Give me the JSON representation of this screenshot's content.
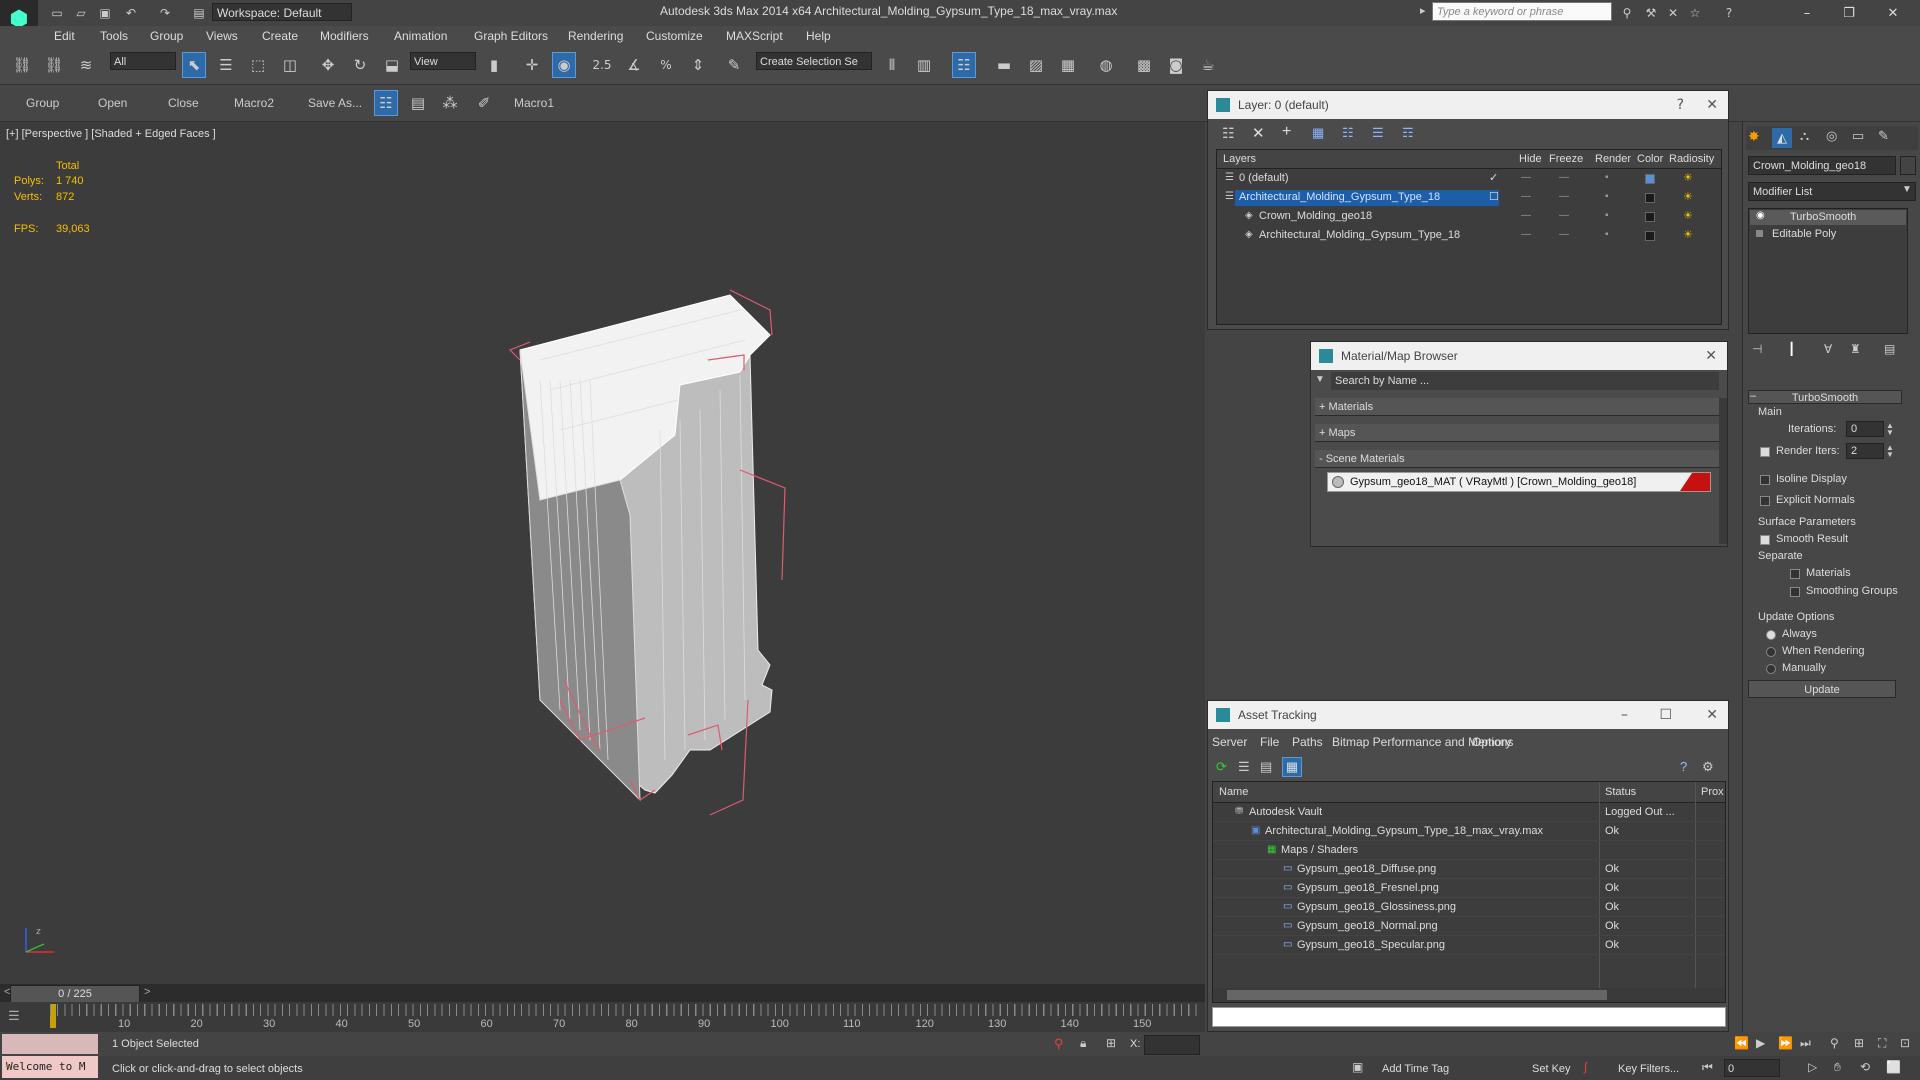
{
  "app": {
    "workspace": "Workspace: Default",
    "title": "Autodesk 3ds Max  2014 x64    Architectural_Molding_Gypsum_Type_18_max_vray.max",
    "search_placeholder": "Type a keyword or phrase"
  },
  "menu": [
    "Edit",
    "Tools",
    "Group",
    "Views",
    "Create",
    "Modifiers",
    "Animation",
    "Graph Editors",
    "Rendering",
    "Customize",
    "MAXScript",
    "Help"
  ],
  "toolbar": {
    "filter": "All",
    "ref_coord": "View",
    "snap_angle": "2.5",
    "selection_set": "Create Selection Se"
  },
  "toolbar2": [
    "Group",
    "Open",
    "Close",
    "Macro2",
    "Save As...",
    "Macro1"
  ],
  "viewport": {
    "label": "[+] [Perspective ] [Shaded + Edged Faces ]",
    "stats": {
      "total_label": "Total",
      "polys_label": "Polys:",
      "polys": "1 740",
      "verts_label": "Verts:",
      "verts": "872",
      "fps_label": "FPS:",
      "fps": "39,063"
    },
    "axis": {
      "x": "x",
      "y": "y",
      "z": "z"
    }
  },
  "timeline": {
    "position": "0 / 225",
    "ticks": [
      "10",
      "20",
      "30",
      "40",
      "50",
      "60",
      "70",
      "80",
      "90",
      "100",
      "110",
      "120",
      "130",
      "140",
      "150"
    ]
  },
  "status": {
    "welcome": "Welcome to M",
    "selected": "1 Object Selected",
    "hint": "Click or click-and-drag to select objects",
    "x_label": "X:",
    "add_time_tag": "Add Time Tag",
    "set_key": "Set Key",
    "key_filters": "Key Filters...",
    "frame": "0"
  },
  "layer_panel": {
    "title": "Layer: 0 (default)",
    "help": "?",
    "columns": [
      "Layers",
      "Hide",
      "Freeze",
      "Render",
      "Color",
      "Radiosity"
    ],
    "rows": [
      {
        "name": "0 (default)",
        "indent": 0,
        "color": "#5b8fd8",
        "active": true
      },
      {
        "name": "Architectural_Molding_Gypsum_Type_18",
        "indent": 0,
        "color": "#1a1a1a",
        "selected": true
      },
      {
        "name": "Crown_Molding_geo18",
        "indent": 1,
        "color": "#1a1a1a"
      },
      {
        "name": "Architectural_Molding_Gypsum_Type_18",
        "indent": 1,
        "color": "#1a1a1a"
      }
    ]
  },
  "material_browser": {
    "title": "Material/Map Browser",
    "search": "Search by Name ...",
    "groups": [
      "+ Materials",
      "+ Maps",
      "- Scene Materials"
    ],
    "item": "Gypsum_geo18_MAT ( VRayMtl ) [Crown_Molding_geo18]",
    "swatch": "#c81010"
  },
  "asset_tracking": {
    "title": "Asset Tracking",
    "menu": [
      "Server",
      "File",
      "Paths",
      "Bitmap Performance and Memory",
      "Options"
    ],
    "columns": [
      "Name",
      "Status",
      "Prox"
    ],
    "rows": [
      {
        "name": "Autodesk Vault",
        "status": "Logged Out ...",
        "indent": 0
      },
      {
        "name": "Architectural_Molding_Gypsum_Type_18_max_vray.max",
        "status": "Ok",
        "indent": 1
      },
      {
        "name": "Maps / Shaders",
        "status": "",
        "indent": 2
      },
      {
        "name": "Gypsum_geo18_Diffuse.png",
        "status": "Ok",
        "indent": 3
      },
      {
        "name": "Gypsum_geo18_Fresnel.png",
        "status": "Ok",
        "indent": 3
      },
      {
        "name": "Gypsum_geo18_Glossiness.png",
        "status": "Ok",
        "indent": 3
      },
      {
        "name": "Gypsum_geo18_Normal.png",
        "status": "Ok",
        "indent": 3
      },
      {
        "name": "Gypsum_geo18_Specular.png",
        "status": "Ok",
        "indent": 3
      }
    ]
  },
  "command_panel": {
    "object_name": "Crown_Molding_geo18",
    "modifier_list": "Modifier List",
    "stack": [
      "TurboSmooth",
      "Editable Poly"
    ],
    "rollout_title": "TurboSmooth",
    "main_label": "Main",
    "iterations_label": "Iterations:",
    "iterations": "0",
    "render_iters_label": "Render Iters:",
    "render_iters": "2",
    "isoline": "Isoline Display",
    "explicit_normals": "Explicit Normals",
    "surface_params": "Surface Parameters",
    "smooth_result": "Smooth Result",
    "separate": "Separate",
    "materials": "Materials",
    "smoothing_groups": "Smoothing Groups",
    "update_options": "Update Options",
    "always": "Always",
    "when_rendering": "When Rendering",
    "manually": "Manually",
    "update": "Update"
  }
}
